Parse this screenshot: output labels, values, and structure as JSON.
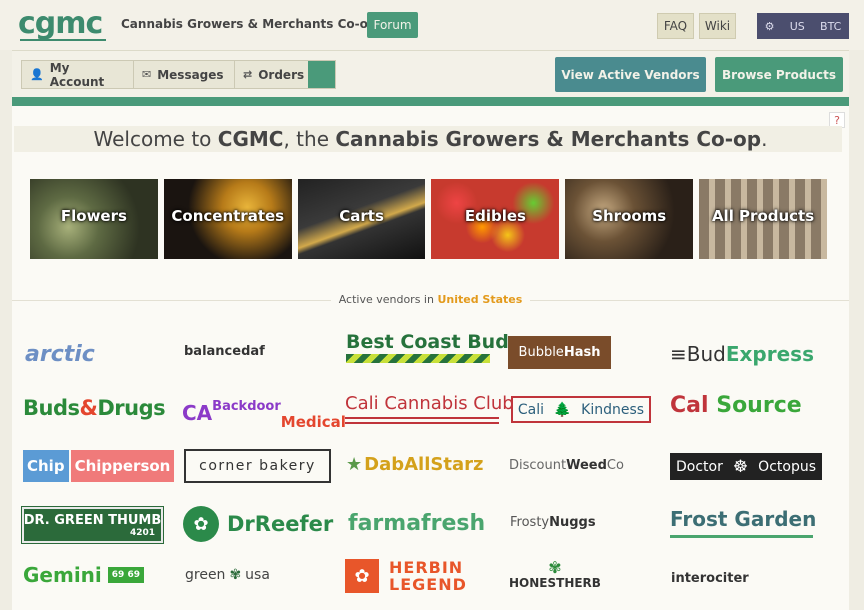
{
  "header": {
    "logo": "cgmc",
    "site_name": "Cannabis Growers & Merchants Co-op",
    "forum": "Forum",
    "faq": "FAQ",
    "wiki": "Wiki",
    "prefs": {
      "gear": "⚙",
      "country": "US",
      "currency": "BTC"
    }
  },
  "nav": {
    "account": "My Account",
    "messages": "Messages",
    "orders": "Orders",
    "view_vendors": "View Active Vendors",
    "browse_products": "Browse Products"
  },
  "main": {
    "help": "?",
    "welcome_prefix": "Welcome to ",
    "welcome_brand": "CGMC",
    "welcome_mid": ", the ",
    "welcome_name": "Cannabis Growers & Merchants Co-op",
    "welcome_suffix": ".",
    "categories": [
      "Flowers",
      "Concentrates",
      "Carts",
      "Edibles",
      "Shrooms",
      "All Products"
    ],
    "vendors_label": "Active vendors in ",
    "vendors_country": "United States"
  },
  "vendors": {
    "arctic": "arctic",
    "balancedaf": "balancedaf",
    "bestcoastbud": "Best Coast Bud",
    "bubblehash_a": "Bubble",
    "bubblehash_b": "Hash",
    "budexpress_a": "≡Bud",
    "budexpress_b": "Express",
    "buds": "Buds",
    "amp": "&",
    "drugs": "Drugs",
    "ca": "CA",
    "backdoor": "Backdoor",
    "medical": "Medical",
    "calicannabisclub": "Cali Cannabis Club",
    "calikindness_a": "Cali",
    "calikindness_b": "Kindness",
    "cal": "Cal",
    "source": "Source",
    "chip": "Chip",
    "chipperson": "Chipperson",
    "cornerbakery": "corner bakery",
    "dab_star": "★",
    "daballstarz": "DabAllStarz",
    "discount_a": "Discount",
    "discount_b": "Weed",
    "discount_c": "Co",
    "droct_a": "Doctor",
    "droct_b": "Octopus",
    "drgreen_a": "DR. GREEN THUMB",
    "drgreen_b": "4201",
    "drreefer": "DrReefer",
    "farmafresh": "farmafresh",
    "frosty_a": "Frosty",
    "frosty_b": "Nuggs",
    "frostgarden": "Frost Garden",
    "gemini": "Gemini",
    "gemini_num": "69 69",
    "green": "green",
    "usa": "usa",
    "herbin_a": "HERBIN",
    "herbin_b": "LEGEND",
    "honestherb": "HONESTHERB",
    "interociter": "interociter"
  },
  "colors": {
    "brand_green": "#4a9a7a",
    "teal_button": "#4a8b8f",
    "country_highlight": "#e39a1c"
  }
}
